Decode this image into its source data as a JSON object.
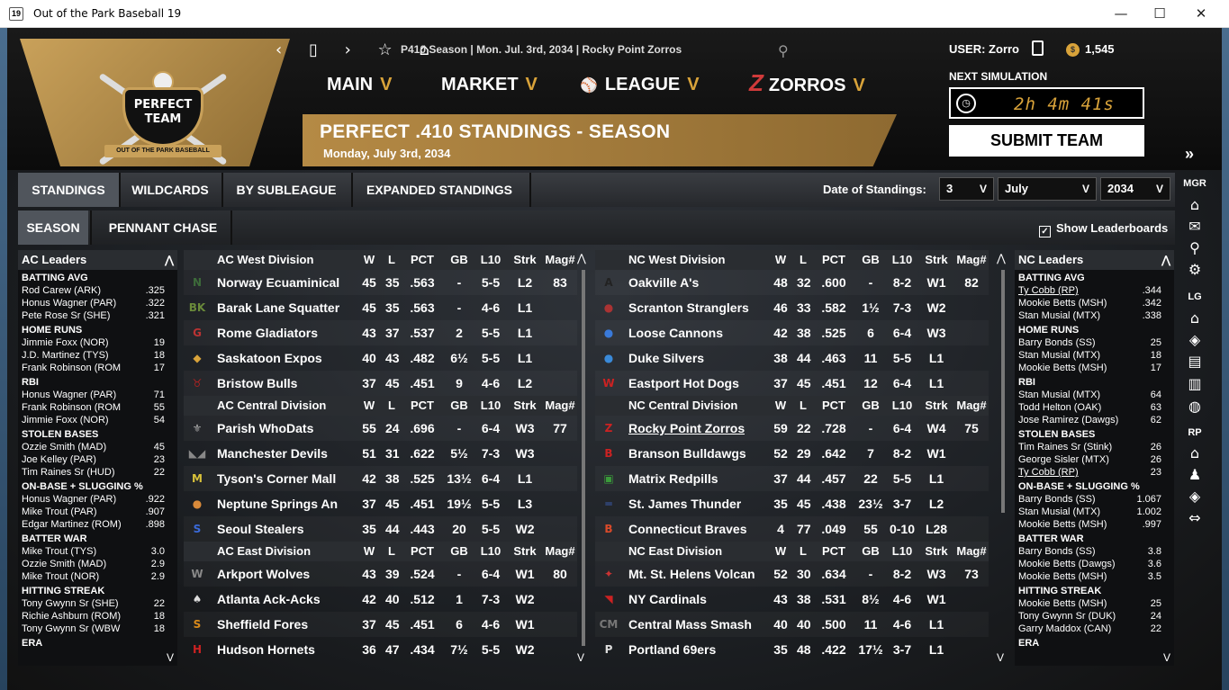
{
  "window": {
    "title": "Out of the Park Baseball 19",
    "icon_text": "19",
    "min": "—",
    "max": "☐",
    "close": "✕"
  },
  "header": {
    "nav_icons": [
      "‹",
      "▯",
      "›",
      "☆",
      "⌂"
    ],
    "breadcrumb": "P410 Season  |  Mon. Jul. 3rd, 2034  |  Rocky Point Zorros",
    "logo_text_1": "PERFECT",
    "logo_text_2": "TEAM",
    "logo_ribbon": "OUT OF THE PARK BASEBALL",
    "menus": [
      {
        "label": "MAIN",
        "chev": "V"
      },
      {
        "label": "MARKET",
        "chev": "V"
      },
      {
        "label": "LEAGUE",
        "chev": "V"
      },
      {
        "label": "ZORROS",
        "chev": "V"
      }
    ],
    "title": "PERFECT .410 STANDINGS - SEASON",
    "subtitle": "Monday, July 3rd, 2034",
    "user": "USER: Zorro",
    "coins": "1,545",
    "next_sim_label": "NEXT SIMULATION",
    "timer": "2h 4m 41s",
    "submit": "SUBMIT TEAM",
    "expand": "»"
  },
  "tabs": [
    "STANDINGS",
    "WILDCARDS",
    "BY SUBLEAGUE",
    "EXPANDED STANDINGS"
  ],
  "subtabs": [
    "SEASON",
    "PENNANT CHASE"
  ],
  "date_of_standings": {
    "label": "Date of Standings:",
    "day": "3",
    "month": "July",
    "year": "2034"
  },
  "show_leaderboards": "Show Leaderboards",
  "columns": [
    "W",
    "L",
    "PCT",
    "GB",
    "L10",
    "Strk",
    "Mag#"
  ],
  "ac_leaders": {
    "title": "AC Leaders",
    "categories": [
      {
        "name": "BATTING AVG",
        "rows": [
          [
            "Rod Carew (ARK)",
            ".325"
          ],
          [
            "Honus Wagner (PAR)",
            ".322"
          ],
          [
            "Pete Rose Sr (SHE)",
            ".321"
          ]
        ]
      },
      {
        "name": "HOME RUNS",
        "rows": [
          [
            "Jimmie Foxx (NOR)",
            "19"
          ],
          [
            "J.D. Martinez (TYS)",
            "18"
          ],
          [
            "Frank Robinson (ROM",
            "17"
          ]
        ]
      },
      {
        "name": "RBI",
        "rows": [
          [
            "Honus Wagner (PAR)",
            "71"
          ],
          [
            "Frank Robinson (ROM",
            "55"
          ],
          [
            "Jimmie Foxx (NOR)",
            "54"
          ]
        ]
      },
      {
        "name": "STOLEN BASES",
        "rows": [
          [
            "Ozzie Smith (MAD)",
            "45"
          ],
          [
            "Joe Kelley (PAR)",
            "23"
          ],
          [
            "Tim Raines Sr (HUD)",
            "22"
          ]
        ]
      },
      {
        "name": "ON-BASE + SLUGGING %",
        "rows": [
          [
            "Honus Wagner (PAR)",
            ".922"
          ],
          [
            "Mike Trout (PAR)",
            ".907"
          ],
          [
            "Edgar Martinez (ROM)",
            ".898"
          ]
        ]
      },
      {
        "name": "BATTER WAR",
        "rows": [
          [
            "Mike Trout (TYS)",
            "3.0"
          ],
          [
            "Ozzie Smith (MAD)",
            "2.9"
          ],
          [
            "Mike Trout (NOR)",
            "2.9"
          ]
        ]
      },
      {
        "name": "HITTING STREAK",
        "rows": [
          [
            "Tony Gwynn Sr (SHE)",
            "22"
          ],
          [
            "Richie Ashburn (ROM)",
            "18"
          ],
          [
            "Tony Gwynn Sr (WBW",
            "18"
          ]
        ]
      },
      {
        "name": "ERA",
        "rows": []
      }
    ]
  },
  "nc_leaders": {
    "title": "NC Leaders",
    "categories": [
      {
        "name": "BATTING AVG",
        "rows": [
          [
            "Ty Cobb (RP)",
            ".344"
          ],
          [
            "Mookie Betts (MSH)",
            ".342"
          ],
          [
            "Stan Musial (MTX)",
            ".338"
          ]
        ]
      },
      {
        "name": "HOME RUNS",
        "rows": [
          [
            "Barry Bonds (SS)",
            "25"
          ],
          [
            "Stan Musial (MTX)",
            "18"
          ],
          [
            "Mookie Betts (MSH)",
            "17"
          ]
        ]
      },
      {
        "name": "RBI",
        "rows": [
          [
            "Stan Musial (MTX)",
            "64"
          ],
          [
            "Todd Helton (OAK)",
            "63"
          ],
          [
            "Jose Ramirez (Dawgs)",
            "62"
          ]
        ]
      },
      {
        "name": "STOLEN BASES",
        "rows": [
          [
            "Tim Raines Sr (Stink)",
            "26"
          ],
          [
            "George Sisler (MTX)",
            "26"
          ],
          [
            "Ty Cobb (RP)",
            "23"
          ]
        ]
      },
      {
        "name": "ON-BASE + SLUGGING %",
        "rows": [
          [
            "Barry Bonds (SS)",
            "1.067"
          ],
          [
            "Stan Musial (MTX)",
            "1.002"
          ],
          [
            "Mookie Betts (MSH)",
            ".997"
          ]
        ]
      },
      {
        "name": "BATTER WAR",
        "rows": [
          [
            "Barry Bonds (SS)",
            "3.8"
          ],
          [
            "Mookie Betts (Dawgs)",
            "3.6"
          ],
          [
            "Mookie Betts (MSH)",
            "3.5"
          ]
        ]
      },
      {
        "name": "HITTING STREAK",
        "rows": [
          [
            "Mookie Betts (MSH)",
            "25"
          ],
          [
            "Tony Gwynn Sr (DUK)",
            "24"
          ],
          [
            "Garry Maddox (CAN)",
            "22"
          ]
        ]
      },
      {
        "name": "ERA",
        "rows": []
      }
    ]
  },
  "ac_divisions": [
    {
      "name": "AC West Division",
      "teams": [
        {
          "name": "Norway Ecuaminical",
          "w": "45",
          "l": "35",
          "pct": ".563",
          "gb": "-",
          "l10": "5-5",
          "strk": "L2",
          "mag": "83",
          "logo": "N",
          "logo_color": "#3d6b3a"
        },
        {
          "name": "Barak Lane Squatter",
          "w": "45",
          "l": "35",
          "pct": ".563",
          "gb": "-",
          "l10": "4-6",
          "strk": "L1",
          "mag": "",
          "logo": "BK",
          "logo_color": "#6a8a3a"
        },
        {
          "name": "Rome Gladiators",
          "w": "43",
          "l": "37",
          "pct": ".537",
          "gb": "2",
          "l10": "5-5",
          "strk": "L1",
          "mag": "",
          "logo": "G",
          "logo_color": "#b33"
        },
        {
          "name": "Saskatoon Expos",
          "w": "40",
          "l": "43",
          "pct": ".482",
          "gb": "6½",
          "l10": "5-5",
          "strk": "L1",
          "mag": "",
          "logo": "◆",
          "logo_color": "#d9a33a"
        },
        {
          "name": "Bristow Bulls",
          "w": "37",
          "l": "45",
          "pct": ".451",
          "gb": "9",
          "l10": "4-6",
          "strk": "L2",
          "mag": "",
          "logo": "♉",
          "logo_color": "#a22"
        }
      ]
    },
    {
      "name": "AC Central Division",
      "teams": [
        {
          "name": "Parish WhoDats",
          "w": "55",
          "l": "24",
          "pct": ".696",
          "gb": "-",
          "l10": "6-4",
          "strk": "W3",
          "mag": "77",
          "logo": "⚜",
          "logo_color": "#aaa"
        },
        {
          "name": "Manchester Devils",
          "w": "51",
          "l": "31",
          "pct": ".622",
          "gb": "5½",
          "l10": "7-3",
          "strk": "W3",
          "mag": "",
          "logo": "◣◢",
          "logo_color": "#888"
        },
        {
          "name": "Tyson's Corner Mall",
          "w": "42",
          "l": "38",
          "pct": ".525",
          "gb": "13½",
          "l10": "6-4",
          "strk": "L1",
          "mag": "",
          "logo": "M",
          "logo_color": "#d9c23a"
        },
        {
          "name": "Neptune Springs An",
          "w": "37",
          "l": "45",
          "pct": ".451",
          "gb": "19½",
          "l10": "5-5",
          "strk": "L3",
          "mag": "",
          "logo": "●",
          "logo_color": "#d98a3a"
        },
        {
          "name": "Seoul Stealers",
          "w": "35",
          "l": "44",
          "pct": ".443",
          "gb": "20",
          "l10": "5-5",
          "strk": "W2",
          "mag": "",
          "logo": "S",
          "logo_color": "#3a6ad9"
        }
      ]
    },
    {
      "name": "AC East Division",
      "teams": [
        {
          "name": "Arkport Wolves",
          "w": "43",
          "l": "39",
          "pct": ".524",
          "gb": "-",
          "l10": "6-4",
          "strk": "W1",
          "mag": "80",
          "logo": "W",
          "logo_color": "#888"
        },
        {
          "name": "Atlanta Ack-Acks",
          "w": "42",
          "l": "40",
          "pct": ".512",
          "gb": "1",
          "l10": "7-3",
          "strk": "W2",
          "mag": "",
          "logo": "♠",
          "logo_color": "#ddd"
        },
        {
          "name": "Sheffield Fores",
          "w": "37",
          "l": "45",
          "pct": ".451",
          "gb": "6",
          "l10": "4-6",
          "strk": "W1",
          "mag": "",
          "logo": "S",
          "logo_color": "#d98a1a"
        },
        {
          "name": "Hudson Hornets",
          "w": "36",
          "l": "47",
          "pct": ".434",
          "gb": "7½",
          "l10": "5-5",
          "strk": "W2",
          "mag": "",
          "logo": "H",
          "logo_color": "#c22"
        }
      ]
    }
  ],
  "nc_divisions": [
    {
      "name": "NC West Division",
      "teams": [
        {
          "name": "Oakville A's",
          "w": "48",
          "l": "32",
          "pct": ".600",
          "gb": "-",
          "l10": "8-2",
          "strk": "W1",
          "mag": "82",
          "logo": "A",
          "logo_color": "#222"
        },
        {
          "name": "Scranton Stranglers",
          "w": "46",
          "l": "33",
          "pct": ".582",
          "gb": "1½",
          "l10": "7-3",
          "strk": "W2",
          "mag": "",
          "logo": "●",
          "logo_color": "#a33"
        },
        {
          "name": "Loose Cannons",
          "w": "42",
          "l": "38",
          "pct": ".525",
          "gb": "6",
          "l10": "6-4",
          "strk": "W3",
          "mag": "",
          "logo": "●",
          "logo_color": "#3a7ad9"
        },
        {
          "name": "Duke Silvers",
          "w": "38",
          "l": "44",
          "pct": ".463",
          "gb": "11",
          "l10": "5-5",
          "strk": "L1",
          "mag": "",
          "logo": "●",
          "logo_color": "#3a8ad9"
        },
        {
          "name": "Eastport Hot Dogs",
          "w": "37",
          "l": "45",
          "pct": ".451",
          "gb": "12",
          "l10": "6-4",
          "strk": "L1",
          "mag": "",
          "logo": "W",
          "logo_color": "#c22"
        }
      ]
    },
    {
      "name": "NC Central Division",
      "teams": [
        {
          "name": "Rocky Point Zorros",
          "w": "59",
          "l": "22",
          "pct": ".728",
          "gb": "-",
          "l10": "6-4",
          "strk": "W4",
          "mag": "75",
          "logo": "Z",
          "logo_color": "#c22",
          "underline": true
        },
        {
          "name": "Branson Bulldawgs",
          "w": "52",
          "l": "29",
          "pct": ".642",
          "gb": "7",
          "l10": "8-2",
          "strk": "W1",
          "mag": "",
          "logo": "B",
          "logo_color": "#c22"
        },
        {
          "name": "Matrix Redpills",
          "w": "37",
          "l": "44",
          "pct": ".457",
          "gb": "22",
          "l10": "5-5",
          "strk": "L1",
          "mag": "",
          "logo": "▣",
          "logo_color": "#3a9a3a"
        },
        {
          "name": "St. James Thunder",
          "w": "35",
          "l": "45",
          "pct": ".438",
          "gb": "23½",
          "l10": "3-7",
          "strk": "L2",
          "mag": "",
          "logo": "═",
          "logo_color": "#3a5aa9"
        },
        {
          "name": "Connecticut Braves",
          "w": "4",
          "l": "77",
          "pct": ".049",
          "gb": "55",
          "l10": "0-10",
          "strk": "L28",
          "mag": "",
          "logo": "B",
          "logo_color": "#d94a2a"
        }
      ]
    },
    {
      "name": "NC East Division",
      "teams": [
        {
          "name": "Mt. St. Helens Volcan",
          "w": "52",
          "l": "30",
          "pct": ".634",
          "gb": "-",
          "l10": "8-2",
          "strk": "W3",
          "mag": "73",
          "logo": "✦",
          "logo_color": "#c33"
        },
        {
          "name": "NY Cardinals",
          "w": "43",
          "l": "38",
          "pct": ".531",
          "gb": "8½",
          "l10": "4-6",
          "strk": "W1",
          "mag": "",
          "logo": "◥",
          "logo_color": "#c22"
        },
        {
          "name": "Central Mass Smash",
          "w": "40",
          "l": "40",
          "pct": ".500",
          "gb": "11",
          "l10": "4-6",
          "strk": "L1",
          "mag": "",
          "logo": "CM",
          "logo_color": "#777"
        },
        {
          "name": "Portland 69ers",
          "w": "35",
          "l": "48",
          "pct": ".422",
          "gb": "17½",
          "l10": "3-7",
          "strk": "L1",
          "mag": "",
          "logo": "P",
          "logo_color": "#ddd"
        }
      ]
    }
  ],
  "right_sidebar": {
    "mgr": "MGR",
    "lg": "LG",
    "rp": "RP",
    "mgr_icons": [
      "home-icon",
      "mail-icon",
      "search-icon",
      "gear-icon"
    ],
    "lg_icons": [
      "home-icon",
      "diamond-icon",
      "news-icon",
      "stats-icon",
      "baseball-icon"
    ],
    "rp_icons": [
      "home-icon",
      "roster-icon",
      "diamond-icon",
      "trade-icon"
    ]
  },
  "colors": {
    "accent_gold": "#c9a15a",
    "chevron": "#d9a33a",
    "zorros_red": "#d03a3a"
  }
}
